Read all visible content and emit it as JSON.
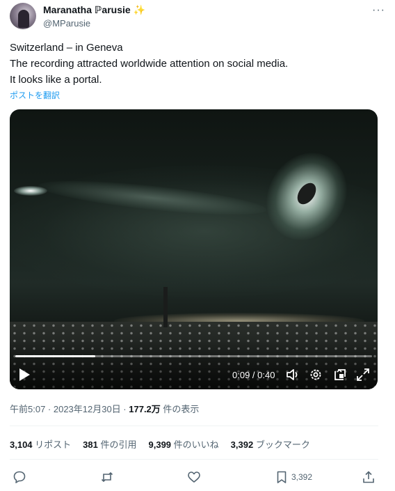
{
  "author": {
    "display_name": "Maranatha ℙarusie",
    "handle": "@MParusie",
    "badge_icon": "sparkles-icon"
  },
  "tweet": {
    "lines": [
      "Switzerland – in Geneva",
      "The recording attracted worldwide attention on social media.",
      "It looks like a portal."
    ],
    "translate_link": "ポストを翻訳"
  },
  "video": {
    "time_display": "0:09 / 0:40",
    "progress_fraction": 0.225,
    "controls": [
      "play-icon",
      "volume-icon",
      "settings-icon",
      "pip-icon",
      "fullscreen-icon"
    ]
  },
  "meta": {
    "time_date": "午前5:07 · 2023年12月30日 · ",
    "views_count": "177.2万",
    "views_label": " 件の表示"
  },
  "stats": [
    {
      "count": "3,104",
      "label": " リポスト"
    },
    {
      "count": "381",
      "label": " 件の引用"
    },
    {
      "count": "9,399",
      "label": " 件のいいね"
    },
    {
      "count": "3,392",
      "label": " ブックマーク"
    }
  ],
  "actions": {
    "bookmark_count": "3,392"
  },
  "colors": {
    "accent": "#1d9bf0",
    "secondary_text": "#536471",
    "primary_text": "#0f1419"
  }
}
